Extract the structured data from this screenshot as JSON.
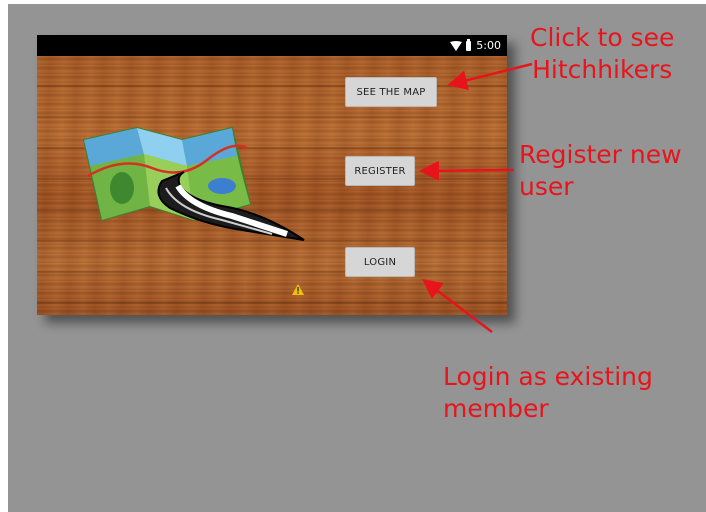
{
  "status_bar": {
    "time": "5:00"
  },
  "buttons": {
    "see_map": "SEE THE MAP",
    "register": "REGISTER",
    "login": "LOGIN"
  },
  "annotations": {
    "see_map": "Click to see\nHitchhikers",
    "register": "Register new\nuser",
    "login": "Login as existing\nmember"
  },
  "colors": {
    "annotation": "#e8141c",
    "button_bg": "#d6d6d6",
    "status_bar": "#000000",
    "canvas_bg": "#949494"
  },
  "icons": [
    "wifi-icon",
    "battery-icon",
    "map-road-logo",
    "warning-icon"
  ]
}
